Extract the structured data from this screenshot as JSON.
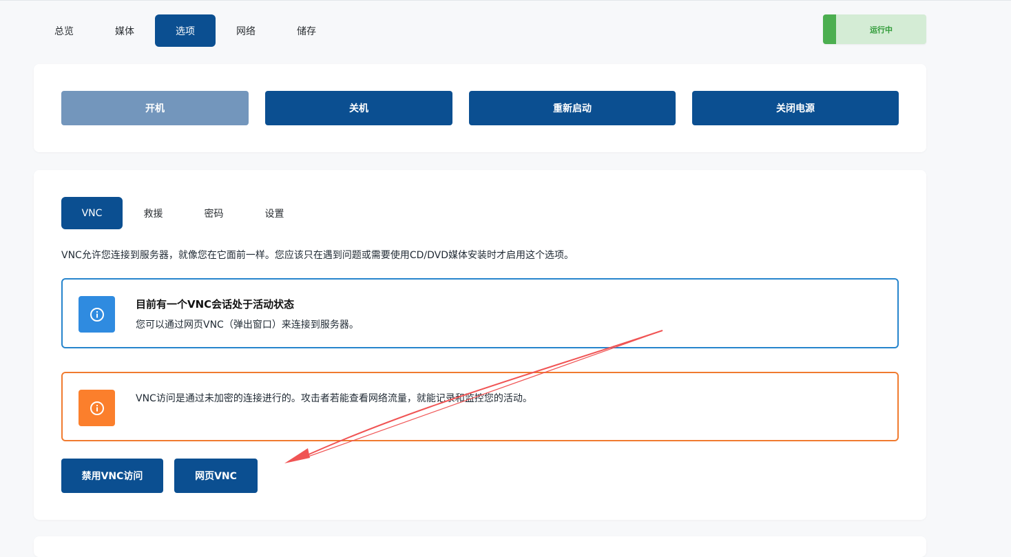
{
  "top_tabs": [
    "总览",
    "媒体",
    "选项",
    "网络",
    "储存"
  ],
  "status": "运行中",
  "power": {
    "start": "开机",
    "shutdown": "关机",
    "restart": "重新启动",
    "power_off": "关闭电源"
  },
  "vnc_tabs": [
    "VNC",
    "救援",
    "密码",
    "设置"
  ],
  "vnc": {
    "description": "VNC允许您连接到服务器，就像您在它面前一样。您应该只在遇到问题或需要使用CD/DVD媒体安装时才启用这个选项。",
    "info_title": "目前有一个VNC会话处于活动状态",
    "info_body": "您可以通过网页VNC（弹出窗口）来连接到服务器。",
    "warning_body": "VNC访问是通过未加密的连接进行的。攻击者若能查看网络流量，就能记录和监控您的活动。",
    "disable_button": "禁用VNC访问",
    "web_vnc_button": "网页VNC"
  },
  "colors": {
    "primary": "#0b4f91",
    "info": "#2f8be0",
    "warning": "#fb7f2c",
    "success": "#4caf50",
    "annotation_arrow": "#f05454"
  },
  "icons": [
    "info-icon",
    "warning-info-icon",
    "annotation-arrow"
  ]
}
